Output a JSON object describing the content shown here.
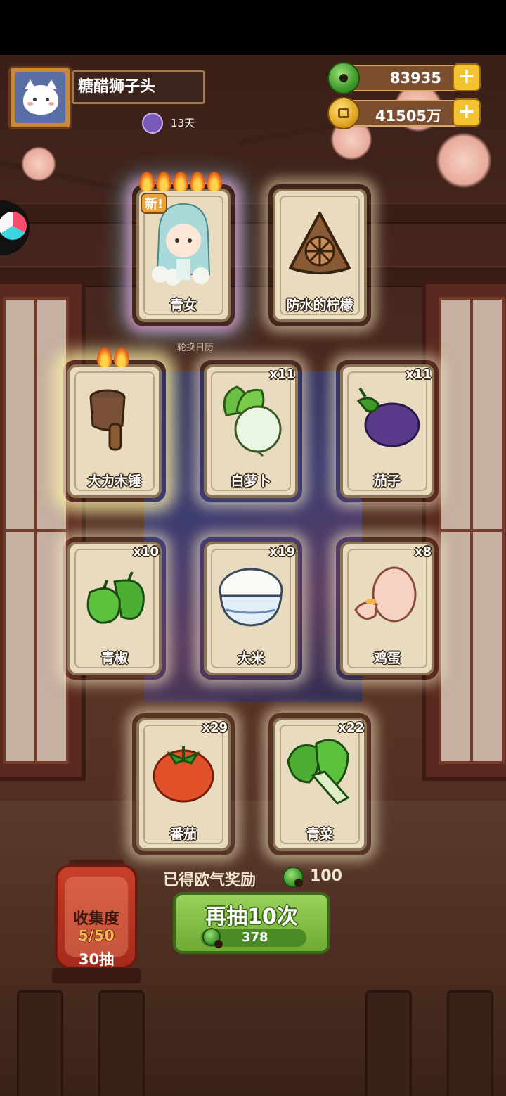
{
  "player": {
    "name": "糖醋狮子头",
    "days": "13天"
  },
  "currency": {
    "jade": "83935",
    "coins": "41505万"
  },
  "rotation_label": "轮换日历",
  "cards": [
    {
      "name": "青女",
      "count": "",
      "badge": "新!",
      "flames": 5,
      "glow": "rainbow"
    },
    {
      "name": "防水的柠檬",
      "count": "",
      "badge": "",
      "flames": 0,
      "glow": "white"
    },
    {
      "name": "大力木锤",
      "count": "",
      "badge": "",
      "flames": 2,
      "glow": "gold"
    },
    {
      "name": "白萝卜",
      "count": "x11",
      "badge": "",
      "flames": 0,
      "glow": "white"
    },
    {
      "name": "茄子",
      "count": "x11",
      "badge": "",
      "flames": 0,
      "glow": "white"
    },
    {
      "name": "青椒",
      "count": "x10",
      "badge": "",
      "flames": 0,
      "glow": "white"
    },
    {
      "name": "大米",
      "count": "x19",
      "badge": "",
      "flames": 0,
      "glow": "white"
    },
    {
      "name": "鸡蛋",
      "count": "x8",
      "badge": "",
      "flames": 0,
      "glow": "white"
    },
    {
      "name": "番茄",
      "count": "x29",
      "badge": "",
      "flames": 0,
      "glow": "white"
    },
    {
      "name": "青菜",
      "count": "x22",
      "badge": "",
      "flames": 0,
      "glow": "white"
    }
  ],
  "reward": {
    "label": "已得欧气奖励",
    "value": "100"
  },
  "draw_button": {
    "label": "再抽10次",
    "cost": "378"
  },
  "collection": {
    "title": "收集度",
    "progress": "5/50",
    "draws": "30抽"
  }
}
